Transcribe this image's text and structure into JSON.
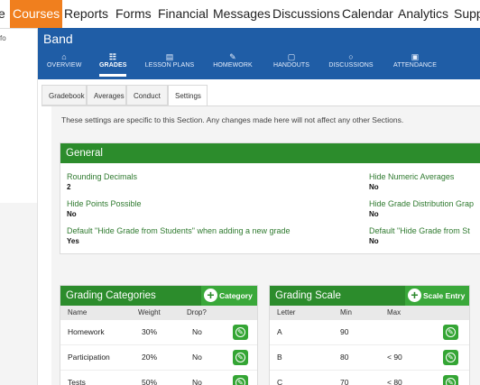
{
  "top_nav": {
    "items": [
      "e",
      "Courses",
      "Reports",
      "Forms",
      "Financial",
      "Messages",
      "Discussions",
      "Calendar",
      "Analytics",
      "Supp"
    ],
    "active": "Courses"
  },
  "left_panel": {
    "label": "fo"
  },
  "section": {
    "title": "Band",
    "tabs": [
      {
        "label": "OVERVIEW",
        "icon": "home-icon",
        "glyph": "⌂"
      },
      {
        "label": "GRADES",
        "icon": "grades-icon",
        "glyph": "☷"
      },
      {
        "label": "LESSON PLANS",
        "icon": "document-icon",
        "glyph": "▤"
      },
      {
        "label": "HOMEWORK",
        "icon": "pencil-icon",
        "glyph": "✎"
      },
      {
        "label": "HANDOUTS",
        "icon": "handout-icon",
        "glyph": "▢"
      },
      {
        "label": "DISCUSSIONS",
        "icon": "chat-icon",
        "glyph": "○"
      },
      {
        "label": "ATTENDANCE",
        "icon": "clipboard-icon",
        "glyph": "▣"
      }
    ],
    "active_tab": "GRADES"
  },
  "sub_tabs": [
    "Gradebook",
    "Averages",
    "Conduct",
    "Settings"
  ],
  "active_sub_tab": "Settings",
  "notice": "These settings are specific to this Section. Any changes made here will not affect any other Sections.",
  "general": {
    "title": "General",
    "left_fields": [
      {
        "label": "Rounding Decimals",
        "value": "2"
      },
      {
        "label": "Hide Points Possible",
        "value": "No"
      },
      {
        "label": "Default \"Hide Grade from Students\" when adding a new grade",
        "value": "Yes"
      }
    ],
    "right_fields": [
      {
        "label": "Hide Numeric Averages",
        "value": "No"
      },
      {
        "label": "Hide Grade Distribution Grap",
        "value": "No"
      },
      {
        "label": "Default \"Hide Grade from St",
        "value": "No"
      }
    ]
  },
  "grading_categories": {
    "title": "Grading Categories",
    "add_label": "Category",
    "columns": [
      "Name",
      "Weight",
      "Drop?"
    ],
    "rows": [
      {
        "name": "Homework",
        "weight": "30%",
        "drop": "No"
      },
      {
        "name": "Participation",
        "weight": "20%",
        "drop": "No"
      },
      {
        "name": "Tests",
        "weight": "50%",
        "drop": "No"
      }
    ]
  },
  "grading_scale": {
    "title": "Grading Scale",
    "add_label": "Scale Entry",
    "columns": [
      "Letter",
      "Min",
      "Max"
    ],
    "rows": [
      {
        "letter": "A",
        "min": "90",
        "max": ""
      },
      {
        "letter": "B",
        "min": "80",
        "max": "< 90"
      },
      {
        "letter": "C",
        "min": "70",
        "max": "< 80"
      }
    ]
  },
  "colors": {
    "accent_orange": "#f07f1e",
    "header_blue": "#1f5da6",
    "green_header": "#2c8c2c",
    "green_button": "#3aa83a",
    "field_label_green": "#2f7a2f"
  }
}
